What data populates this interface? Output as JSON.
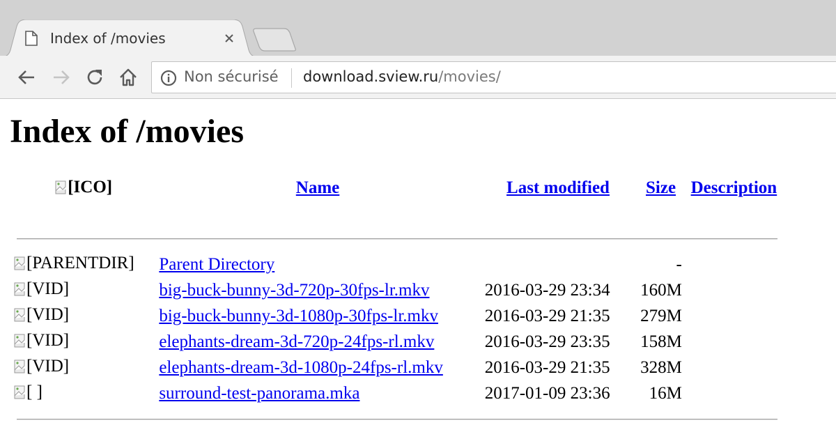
{
  "browser": {
    "tab_title": "Index of /movies",
    "security_label": "Non sécurisé",
    "url_host": "download.sview.ru",
    "url_path": "/movies/"
  },
  "page": {
    "heading": "Index of /movies",
    "columns": {
      "icon": "[ICO]",
      "name": "Name",
      "last_modified": "Last modified",
      "size": "Size",
      "description": "Description"
    },
    "rows": [
      {
        "icon_alt": "[PARENTDIR]",
        "name": "Parent Directory",
        "modified": "",
        "size": "-",
        "description": ""
      },
      {
        "icon_alt": "[VID]",
        "name": "big-buck-bunny-3d-720p-30fps-lr.mkv",
        "modified": "2016-03-29 23:34",
        "size": "160M",
        "description": ""
      },
      {
        "icon_alt": "[VID]",
        "name": "big-buck-bunny-3d-1080p-30fps-lr.mkv",
        "modified": "2016-03-29 21:35",
        "size": "279M",
        "description": ""
      },
      {
        "icon_alt": "[VID]",
        "name": "elephants-dream-3d-720p-24fps-rl.mkv",
        "modified": "2016-03-29 23:35",
        "size": "158M",
        "description": ""
      },
      {
        "icon_alt": "[VID]",
        "name": "elephants-dream-3d-1080p-24fps-rl.mkv",
        "modified": "2016-03-29 21:35",
        "size": "328M",
        "description": ""
      },
      {
        "icon_alt": "[ ]",
        "name": "surround-test-panorama.mka",
        "modified": "2017-01-09 23:36",
        "size": "16M",
        "description": ""
      }
    ]
  }
}
